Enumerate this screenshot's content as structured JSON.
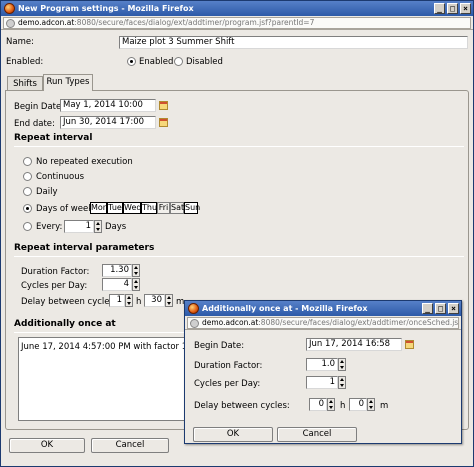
{
  "main_window": {
    "title": "New Program settings - Mozilla Firefox",
    "url_host": "demo.adcon.at",
    "url_path": ":8080/secure/faces/dialog/ext/addtimer/program.jsf?parentId=7",
    "name_label": "Name:",
    "name_value": "Maize plot 3 Summer Shift",
    "enabled_label": "Enabled:",
    "enabled_option": "Enabled",
    "disabled_option": "Disabled",
    "tabs": [
      {
        "label": "Shifts"
      },
      {
        "label": "Run Types"
      }
    ],
    "begin_date_label": "Begin Date:",
    "begin_date_value": "May 1, 2014 10:00",
    "end_date_label": "End date:",
    "end_date_value": "Jun 30, 2014 17:00",
    "repeat_interval_title": "Repeat interval",
    "repeat_options": [
      {
        "label": "No repeated execution",
        "selected": false
      },
      {
        "label": "Continuous",
        "selected": false
      },
      {
        "label": "Daily",
        "selected": false
      },
      {
        "label": "Days of week:",
        "selected": true
      },
      {
        "label": "Every:",
        "selected": false
      }
    ],
    "weekdays": [
      {
        "label": "Mon",
        "selected": true
      },
      {
        "label": "Tue",
        "selected": true
      },
      {
        "label": "Wed",
        "selected": true
      },
      {
        "label": "Thu",
        "selected": true
      },
      {
        "label": "Fri",
        "selected": false
      },
      {
        "label": "Sat",
        "selected": false
      },
      {
        "label": "Sun",
        "selected": true
      }
    ],
    "every_value": "1",
    "every_unit": "Days",
    "params_title": "Repeat interval parameters",
    "duration_label": "Duration Factor:",
    "duration_value": "1.30",
    "cycles_label": "Cycles per Day:",
    "cycles_value": "4",
    "delay_label": "Delay between cycles:",
    "delay_hours": "1",
    "delay_h_unit": "h",
    "delay_minutes": "30",
    "delay_m_unit": "m",
    "once_title": "Additionally once at",
    "once_entry": "June 17, 2014 4:57:00 PM with factor 1",
    "ok_label": "OK",
    "cancel_label": "Cancel"
  },
  "popup": {
    "title": "Additionally once at - Mozilla Firefox",
    "url_host": "demo.adcon.at",
    "url_path": ":8080/secure/faces/dialog/ext/addtimer/onceSched.jsf?parentId=10",
    "begin_label": "Begin Date:",
    "begin_value": "Jun 17, 2014 16:58",
    "duration_label": "Duration Factor:",
    "duration_value": "1.0",
    "cycles_label": "Cycles per Day:",
    "cycles_value": "1",
    "delay_label": "Delay between cycles:",
    "delay_hours": "0",
    "delay_h_unit": "h",
    "delay_minutes": "0",
    "delay_m_unit": "m",
    "ok_label": "OK",
    "cancel_label": "Cancel"
  }
}
